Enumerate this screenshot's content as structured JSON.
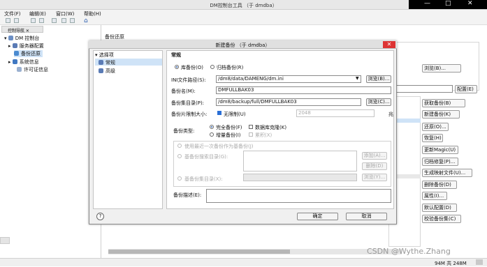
{
  "window": {
    "title": "DM控制台工具 （于 dmdba）"
  },
  "top_overlay": {
    "min": "—",
    "max": "□",
    "close": "✕"
  },
  "menu": [
    "文件(F)",
    "编辑(E)",
    "窗口(W)",
    "帮助(H)"
  ],
  "nav_tab": {
    "label": "控制导航 ✕"
  },
  "tree": {
    "root": "DM 控制台",
    "items": [
      "服务器配置",
      "备份还原",
      "系统信息",
      "许可证信息"
    ]
  },
  "backup_panel_title": "备份还原",
  "right_side": {
    "browse1": "浏览(B)...",
    "config": "配置(E)",
    "buttons": [
      "获取备份(B)",
      "新建备份(K)",
      "还原(O)...",
      "恢复(H)",
      "更新Magic(U)",
      "归档修复(P)...",
      "生成映射文件(U)...",
      "删除备份(D)",
      "属性(I)...",
      "默认配置(D)",
      "校验备份集(C)"
    ]
  },
  "dialog": {
    "title": "新建备份 （于 dmdba）",
    "close": "✕",
    "select_header": "选择项",
    "left_items": [
      "常规",
      "高级"
    ],
    "section": "常规",
    "radio_db": "库备份(O)",
    "radio_arch": "归档备份(R)",
    "ini_label": "INI文件路径(S):",
    "ini_value": "/dm8/data/DAMENG/dm.ini",
    "browse": "浏览(B)...",
    "name_label": "备份名(M):",
    "name_value": "DMFULLBAK03",
    "dir_label": "备份集目录(P):",
    "dir_value": "/dm8/backup/full/DMFULLBAK03",
    "browse2": "浏览(C)...",
    "limit_label": "备份片限制大小:",
    "unlimited": "无限制(U)",
    "limit_value": "2048",
    "unit": "兆",
    "type_label": "备份类型:",
    "full": "完全备份(F)",
    "clone": "数据库克隆(K)",
    "incr": "增量备份(I)",
    "cumulative": "累积(X)",
    "use_recent": "使用最近一次备份作为基备份(J)",
    "base_search": "基备份搜索目录(G):",
    "add": "添加(A)...",
    "delete": "删除(D)",
    "base_dir": "基备份集目录(X):",
    "browse3": "浏览(Y)...",
    "desc_label": "备份描述(E):",
    "help": "?",
    "ok": "确定",
    "cancel": "取消"
  },
  "status": {
    "memory": "94M 共 248M"
  },
  "watermark": "CSDN @Wythe.Zhang"
}
